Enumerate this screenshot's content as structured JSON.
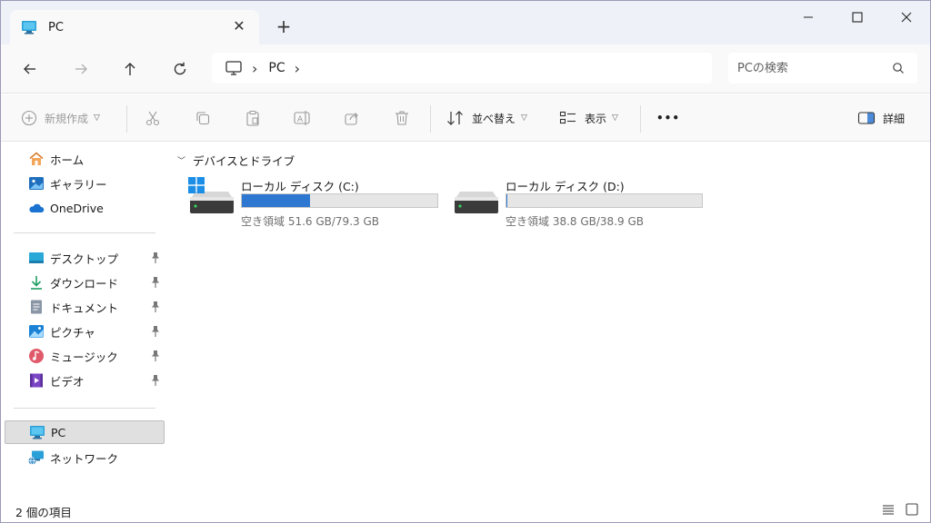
{
  "tab": {
    "title": "PC",
    "close": "✕",
    "new_tab": "+"
  },
  "window_controls": {
    "minimize": "—",
    "maximize": "☐",
    "close": "✕"
  },
  "address": {
    "crumbs": [
      "PC"
    ],
    "search_placeholder": "PCの検索"
  },
  "toolbar": {
    "new_label": "新規作成",
    "sort_label": "並べ替え",
    "view_label": "表示",
    "more_label": "•••",
    "details_label": "詳細"
  },
  "sidebar": {
    "top": [
      {
        "label": "ホーム",
        "icon": "home-icon"
      },
      {
        "label": "ギャラリー",
        "icon": "gallery-icon"
      },
      {
        "label": "OneDrive",
        "icon": "cloud-icon"
      }
    ],
    "quick": [
      {
        "label": "デスクトップ",
        "icon": "desktop-icon"
      },
      {
        "label": "ダウンロード",
        "icon": "download-icon"
      },
      {
        "label": "ドキュメント",
        "icon": "document-icon"
      },
      {
        "label": "ピクチャ",
        "icon": "pictures-icon"
      },
      {
        "label": "ミュージック",
        "icon": "music-icon"
      },
      {
        "label": "ビデオ",
        "icon": "video-icon"
      }
    ],
    "bottom": [
      {
        "label": "PC",
        "icon": "pc-icon",
        "selected": true
      },
      {
        "label": "ネットワーク",
        "icon": "network-icon"
      }
    ]
  },
  "main": {
    "group_title": "デバイスとドライブ",
    "drives": [
      {
        "name": "ローカル ディスク (C:)",
        "free_text": "空き領域 51.6 GB/79.3 GB",
        "used_fraction": 0.35,
        "system": true
      },
      {
        "name": "ローカル ディスク (D:)",
        "free_text": "空き領域 38.8 GB/38.9 GB",
        "used_fraction": 0.003,
        "system": false
      }
    ]
  },
  "status": {
    "item_count": "2 個の項目"
  },
  "colors": {
    "accent": "#2f78d2",
    "titlebar": "#eef1f7",
    "selected": "#e0e0e0"
  }
}
